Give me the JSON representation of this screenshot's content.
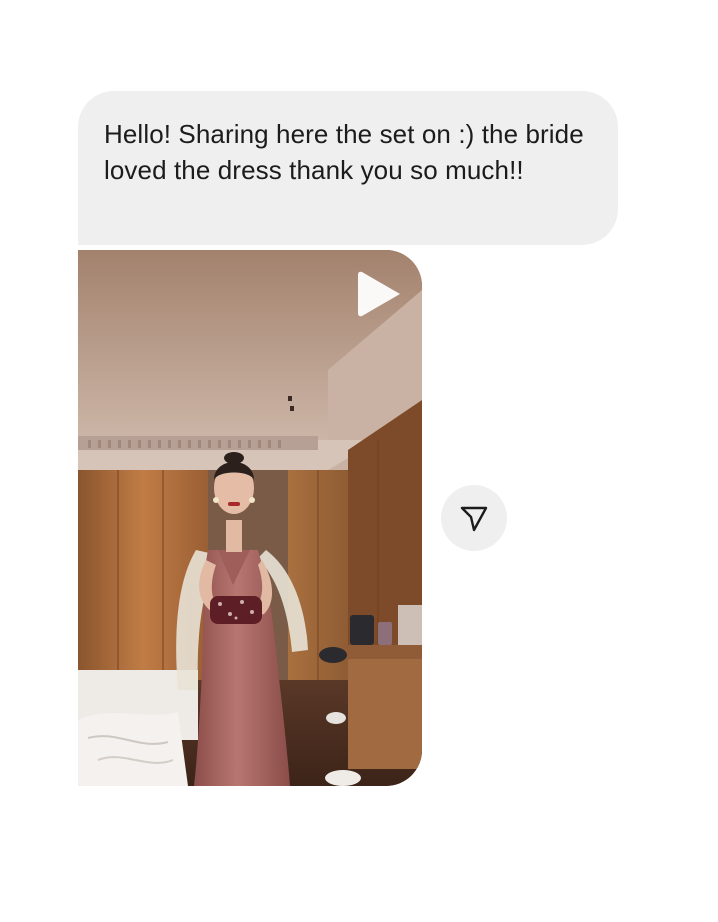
{
  "message": {
    "text": "Hello! Sharing here the set on :) the bride loved the dress thank you so much!!"
  },
  "video": {
    "icon": "play-icon"
  },
  "share": {
    "icon": "send-icon"
  },
  "colors": {
    "bubble": "#efefef",
    "text": "#1c1c1c",
    "background": "#ffffff"
  }
}
